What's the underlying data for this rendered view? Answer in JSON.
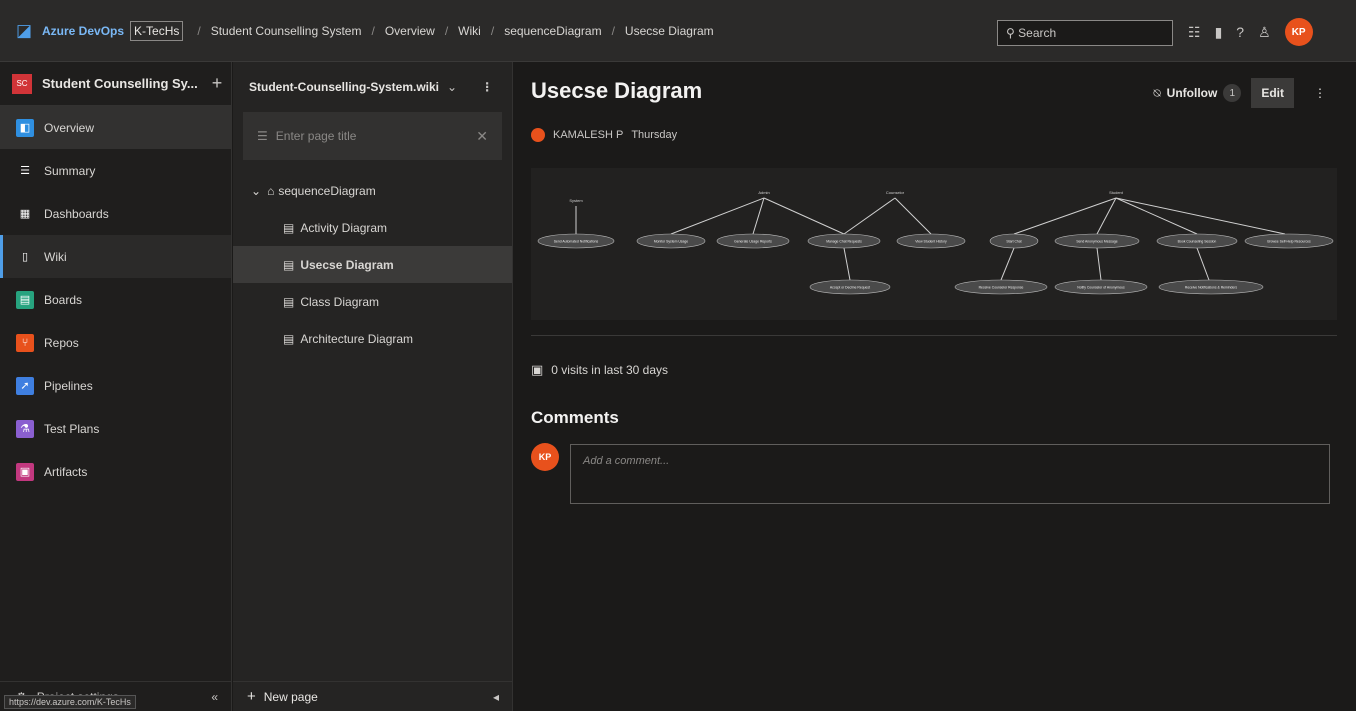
{
  "topbar": {
    "brand": "Azure DevOps",
    "org": "K-TecHs",
    "breadcrumbs": [
      "Student Counselling System",
      "Overview",
      "Wiki",
      "sequenceDiagram",
      "Usecse Diagram"
    ],
    "search_placeholder": "Search",
    "user_initials": "KP"
  },
  "project": {
    "initials": "SC",
    "name": "Student Counselling Sy...",
    "add_label": "+"
  },
  "nav": {
    "items": [
      {
        "label": "Overview",
        "color": "#2f8fe0"
      },
      {
        "label": "Summary",
        "color": "#605e5c"
      },
      {
        "label": "Dashboards",
        "color": "#605e5c"
      },
      {
        "label": "Wiki",
        "color": "#605e5c"
      },
      {
        "label": "Boards",
        "color": "#27a37f"
      },
      {
        "label": "Repos",
        "color": "#e8511c"
      },
      {
        "label": "Pipelines",
        "color": "#3f7fe0"
      },
      {
        "label": "Test Plans",
        "color": "#8a5fd0"
      },
      {
        "label": "Artifacts",
        "color": "#c2387f"
      }
    ],
    "settings_label": "Project settings",
    "status_url": "https://dev.azure.com/K-TecHs"
  },
  "wiki": {
    "name": "Student-Counselling-System.wiki",
    "filter_placeholder": "Enter page title",
    "tree": {
      "root": "sequenceDiagram",
      "children": [
        "Activity Diagram",
        "Usecse Diagram",
        "Class Diagram",
        "Architecture Diagram"
      ]
    },
    "new_page_label": "New page"
  },
  "page": {
    "title": "Usecse Diagram",
    "author": "KAMALESH P",
    "date": "Thursday",
    "unfollow_label": "Unfollow",
    "follower_count": "1",
    "edit_label": "Edit",
    "visits": "0 visits in last 30 days",
    "comments_heading": "Comments",
    "comment_placeholder": "Add a comment..."
  },
  "diagram": {
    "actors": [
      "System",
      "Admin",
      "Counselor",
      "Student"
    ],
    "usecases_row1": [
      "Send Automated Notifications",
      "Monitor System Usage",
      "Generate Usage Reports",
      "Manage Chat Requests",
      "View Student History",
      "Start Chat",
      "Send Anonymous Message",
      "Book Counseling Session",
      "Browse Self-Help Resources"
    ],
    "usecases_row2": [
      "Accept or Decline Request",
      "Receive Counselor Response",
      "Notify Counselor of Anonymous",
      "Receive Notifications & Reminders"
    ]
  }
}
